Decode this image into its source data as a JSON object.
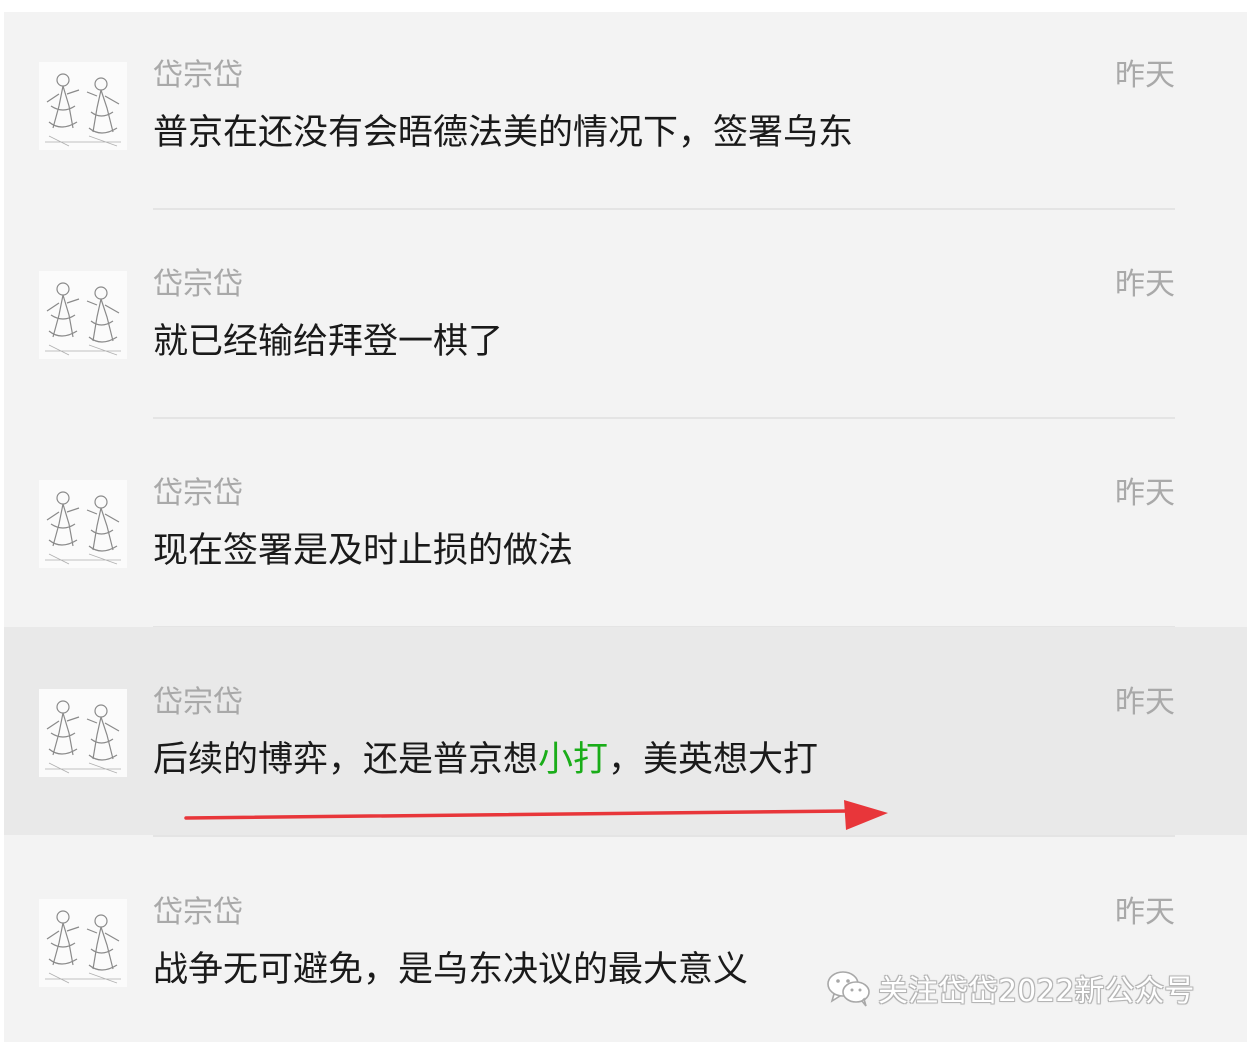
{
  "comments": [
    {
      "name": "岱宗岱",
      "time": "昨天",
      "text": "普京在还没有会晤德法美的情况下，签署乌东",
      "avatar_icon": "sketch-figures-avatar-icon"
    },
    {
      "name": "岱宗岱",
      "time": "昨天",
      "text": "就已经输给拜登一棋了",
      "avatar_icon": "sketch-figures-avatar-icon"
    },
    {
      "name": "岱宗岱",
      "time": "昨天",
      "text": "现在签署是及时止损的做法",
      "avatar_icon": "sketch-figures-avatar-icon"
    },
    {
      "name": "岱宗岱",
      "time": "昨天",
      "text_before": "后续的博弈，还是普京想",
      "text_highlight": "小打",
      "text_after": "，美英想大打",
      "avatar_icon": "sketch-figures-avatar-icon",
      "highlight_color": "#1aad19"
    },
    {
      "name": "岱宗岱",
      "time": "昨天",
      "text": "战争无可避免，是乌东决议的最大意义",
      "avatar_icon": "sketch-figures-avatar-icon"
    }
  ],
  "annotation": {
    "arrow_icon": "red-right-arrow-icon",
    "arrow_color": "#e8363a"
  },
  "watermark": {
    "icon": "wechat-icon",
    "text": "关注岱岱2022新公众号"
  },
  "colors": {
    "background": "#f3f3f3",
    "highlight_row": "#e9e9e9",
    "name_text": "#a9a9a9",
    "body_text": "#1a1a1a"
  }
}
